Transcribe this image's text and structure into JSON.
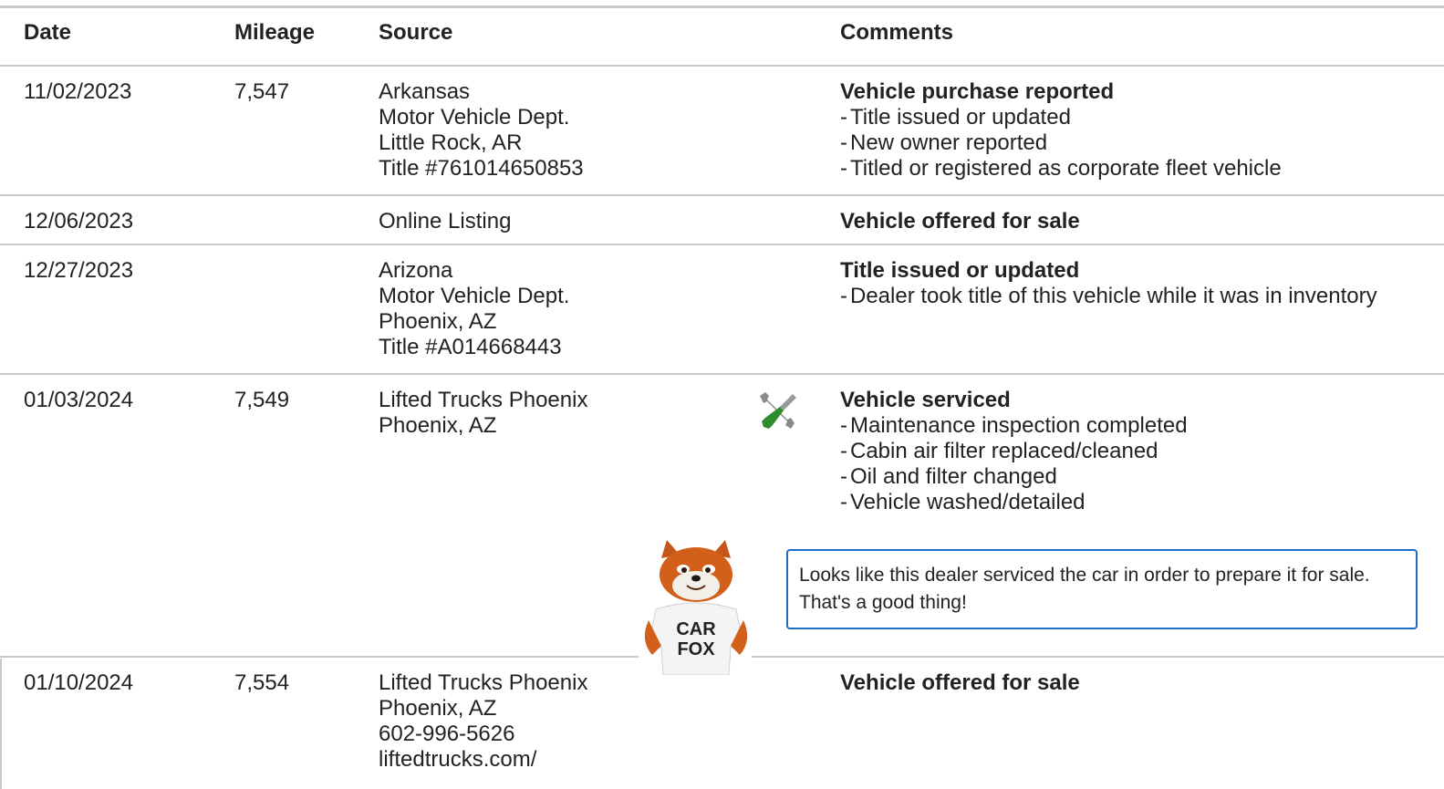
{
  "headers": {
    "date": "Date",
    "mileage": "Mileage",
    "source": "Source",
    "comments": "Comments"
  },
  "rows": [
    {
      "date": "11/02/2023",
      "mileage": "7,547",
      "source": [
        "Arkansas",
        "Motor Vehicle Dept.",
        "Little Rock, AR",
        "Title #761014650853"
      ],
      "comment_title": "Vehicle purchase reported",
      "comment_items": [
        "Title issued or updated",
        "New owner reported",
        "Titled or registered as corporate fleet vehicle"
      ]
    },
    {
      "date": "12/06/2023",
      "mileage": "",
      "source": [
        "Online Listing"
      ],
      "comment_title": "Vehicle offered for sale",
      "comment_items": []
    },
    {
      "date": "12/27/2023",
      "mileage": "",
      "source": [
        "Arizona",
        "Motor Vehicle Dept.",
        "Phoenix, AZ",
        "Title #A014668443"
      ],
      "comment_title": "Title issued or updated",
      "comment_items": [
        "Dealer took title of this vehicle while it was in inventory"
      ]
    },
    {
      "date": "01/03/2024",
      "mileage": "7,549",
      "source": [
        "Lifted Trucks Phoenix",
        "Phoenix, AZ"
      ],
      "comment_title": "Vehicle serviced",
      "comment_items": [
        "Maintenance inspection completed",
        "Cabin air filter replaced/cleaned",
        "Oil and filter changed",
        "Vehicle washed/detailed"
      ]
    },
    {
      "date": "01/10/2024",
      "mileage": "7,554",
      "source": [
        "Lifted Trucks Phoenix",
        "Phoenix, AZ",
        "602-996-5626",
        "liftedtrucks.com/"
      ],
      "comment_title": "Vehicle offered for sale",
      "comment_items": []
    }
  ],
  "service_icon": "wrench-screwdriver-icon",
  "callout_text": "Looks like this dealer serviced the car in order to prepare it for sale. That's a good thing!",
  "mascot": {
    "shirt_line1": "CAR",
    "shirt_line2": "FOX"
  },
  "colors": {
    "border": "#c9c9c9",
    "callout_border": "#1b6ec2",
    "tool_green": "#2e8b2e",
    "fox_orange": "#d2601a"
  }
}
